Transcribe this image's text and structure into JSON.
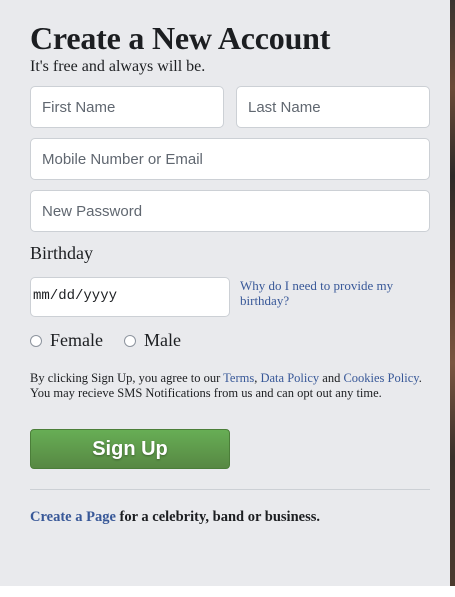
{
  "header": {
    "title": "Create a New Account",
    "subtitle": "It's free and always will be."
  },
  "form": {
    "first_name_placeholder": "First Name",
    "last_name_placeholder": "Last Name",
    "mobile_placeholder": "Mobile Number or Email",
    "password_placeholder": "New Password",
    "birthday_label": "Birthday",
    "date_placeholder": "mm/dd/yyyy",
    "why_link": "Why do I need to provide my birthday?",
    "gender_female": "Female",
    "gender_male": "Male"
  },
  "terms": {
    "intro": "By clicking Sign Up, you agree to our ",
    "terms_link": "Terms",
    "comma": ", ",
    "data_policy_link": "Data Policy",
    "and": " and ",
    "cookies_link": "Cookies Policy",
    "rest": ". You may recieve SMS Notifications from us and can opt out any time."
  },
  "signup_label": "Sign Up",
  "footer": {
    "create_page_link": "Create a Page",
    "rest": " for a celebrity, band or business."
  },
  "colors": {
    "background": "#e9eaed",
    "link": "#385898",
    "signup_green": "#5b9a46"
  }
}
